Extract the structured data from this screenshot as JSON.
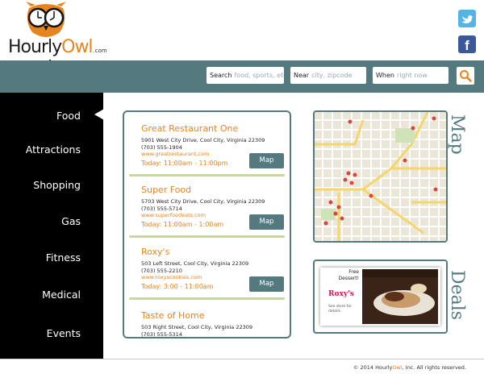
{
  "brand": {
    "name_part1": "Hourly",
    "name_part2": "Owl",
    "tld": ".com"
  },
  "social": {
    "twitter_icon": "twitter-icon",
    "facebook_icon": "facebook-icon",
    "facebook_glyph": "f"
  },
  "search": {
    "search_label": "Search",
    "search_placeholder": "food, sports, etc",
    "near_label": "Near",
    "near_placeholder": "city, zipcode",
    "when_label": "When",
    "when_placeholder": "right now",
    "button_icon": "magnifier-icon"
  },
  "nav": {
    "items": [
      {
        "label": "Food",
        "active": true
      },
      {
        "label": "Attractions"
      },
      {
        "label": "Shopping"
      },
      {
        "label": "Gas"
      },
      {
        "label": "Fitness"
      },
      {
        "label": "Medical"
      },
      {
        "label": "Events"
      }
    ]
  },
  "listings": [
    {
      "name": "Great Restaurant One",
      "address": "5901 West City Drive, Cool City, Virginia 22309",
      "phone": "(703) 555-1904",
      "website": "www.greatrestaurant.com",
      "hours": "Today: 11:00am - 11:00pm",
      "map_label": "Map"
    },
    {
      "name": "Super Food",
      "address": "5703 West City Drive, Cool City, Virginia 22309",
      "phone": "(703) 555-5714",
      "website": "www.superfoodeats.com",
      "hours": "Today: 11:00am - 1:00am",
      "map_label": "Map"
    },
    {
      "name": "Roxy's",
      "address": "503 Left Street, Cool City, Virginia 22309",
      "phone": "(703) 555-2210",
      "website": "www.roxyscookies.com",
      "hours": "Today: 3:00 - 11:00am",
      "map_label": "Map"
    },
    {
      "name": "Taste of Home",
      "address": "503 Right Street, Cool City, Virginia 22309",
      "phone": "(703) 555-5314",
      "website": "",
      "hours": "",
      "map_label": ""
    }
  ],
  "panels": {
    "map_title": "Map",
    "deals_title": "Deals"
  },
  "deal": {
    "headline": "Free Dessert!",
    "brand": "Roxy's",
    "fine_print": "See store for details"
  },
  "footer": {
    "prefix": "© 2014 Hourly",
    "owl": "Owl",
    "suffix": ", Inc. All rights reserved."
  },
  "colors": {
    "accent": "#e8841e",
    "teal": "#547a80",
    "sidebar": "#000000",
    "rule": "#c6d7a4"
  }
}
